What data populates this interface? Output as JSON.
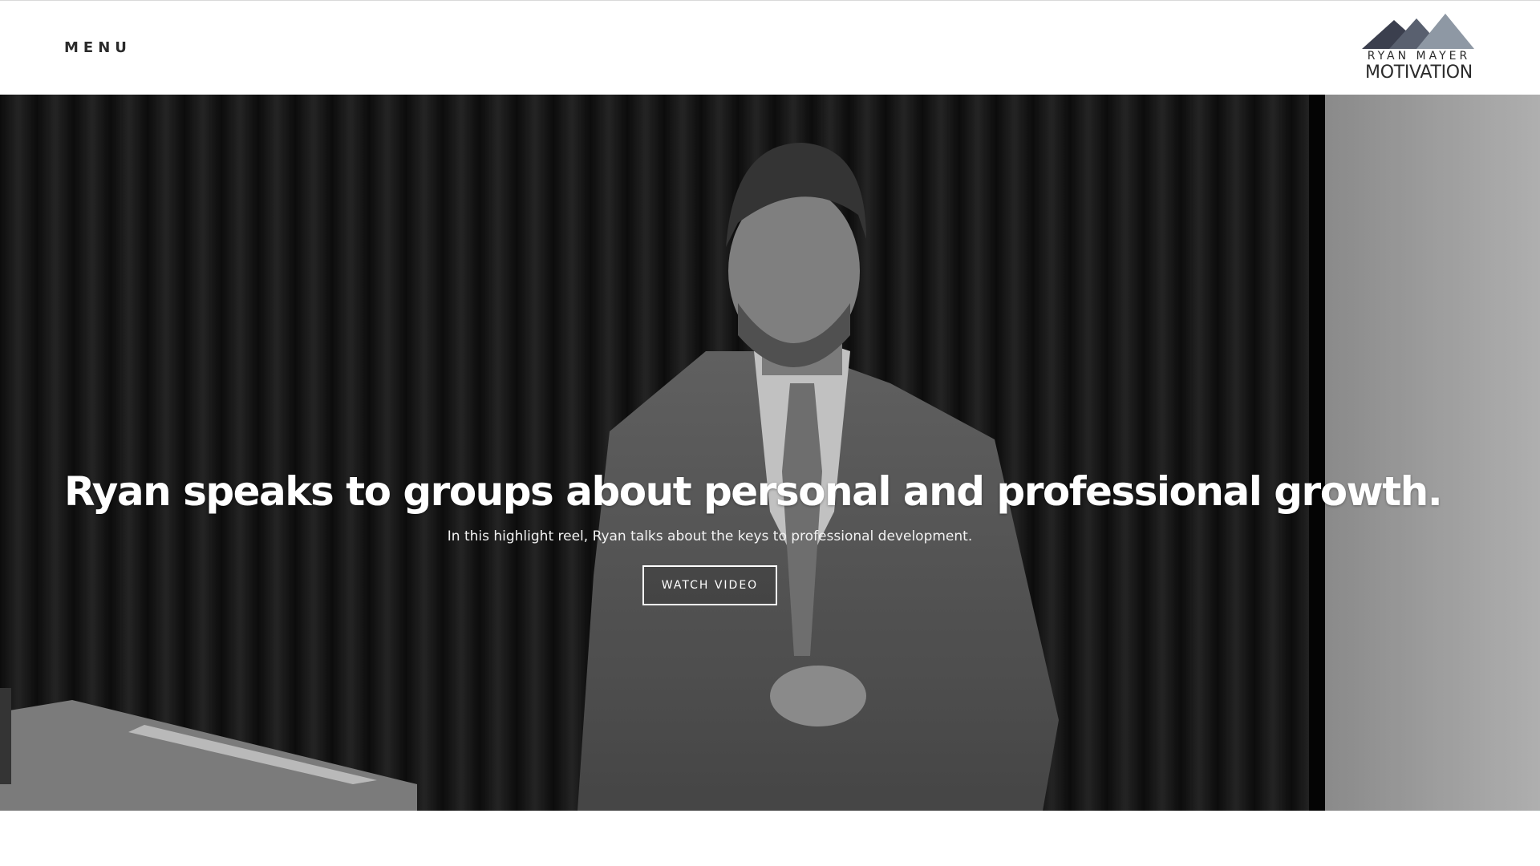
{
  "header": {
    "menu_label": "MENU",
    "logo": {
      "top_line": "RYAN MAYER",
      "bottom_line": "MOTIVATION",
      "icon": "mountain-logo-icon",
      "colors": [
        "#3b3f4e",
        "#59606f",
        "#8e98a4"
      ]
    }
  },
  "hero": {
    "title": "Ryan speaks to groups about personal and professional growth.",
    "subtitle": "In this highlight reel, Ryan talks about the keys to professional development.",
    "cta_label": "WATCH VIDEO",
    "image": "speaker-on-stage-photo"
  },
  "colors": {
    "text_dark": "#2b2b2b",
    "hero_text": "#ffffff",
    "background": "#ffffff"
  }
}
